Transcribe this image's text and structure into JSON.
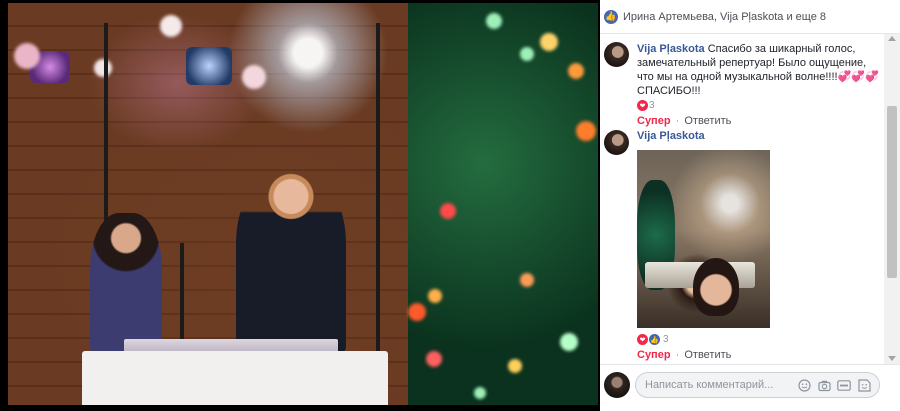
{
  "sidebar": {
    "likers_text": "Ирина Артемьева, Vija Pļaskota и еще 8",
    "comments": [
      {
        "author": "Vija Pļaskota",
        "text": "Спасибо за шикарный голос, замечательный репертуар! Было ощущение, что мы на одной музыкальной волне!!!!💞💞💞 СПАСИБО!!!",
        "reactions_count": "3",
        "action_super": "Супер",
        "action_separator": "·",
        "action_reply": "Ответить"
      },
      {
        "author": "Vija Pļaskota",
        "reactions_count": "3",
        "action_super": "Супер",
        "action_separator": "·",
        "action_reply": "Ответить"
      }
    ],
    "composer": {
      "placeholder": "Написать комментарий..."
    }
  },
  "icons": {
    "like": "like-icon",
    "heart": "heart-reaction-icon",
    "emoji": "emoji-icon",
    "camera": "camera-icon",
    "gif": "gif-icon",
    "sticker": "sticker-icon"
  },
  "colors": {
    "link": "#385898",
    "super": "#f0284a",
    "like_blue": "#4267b2"
  }
}
